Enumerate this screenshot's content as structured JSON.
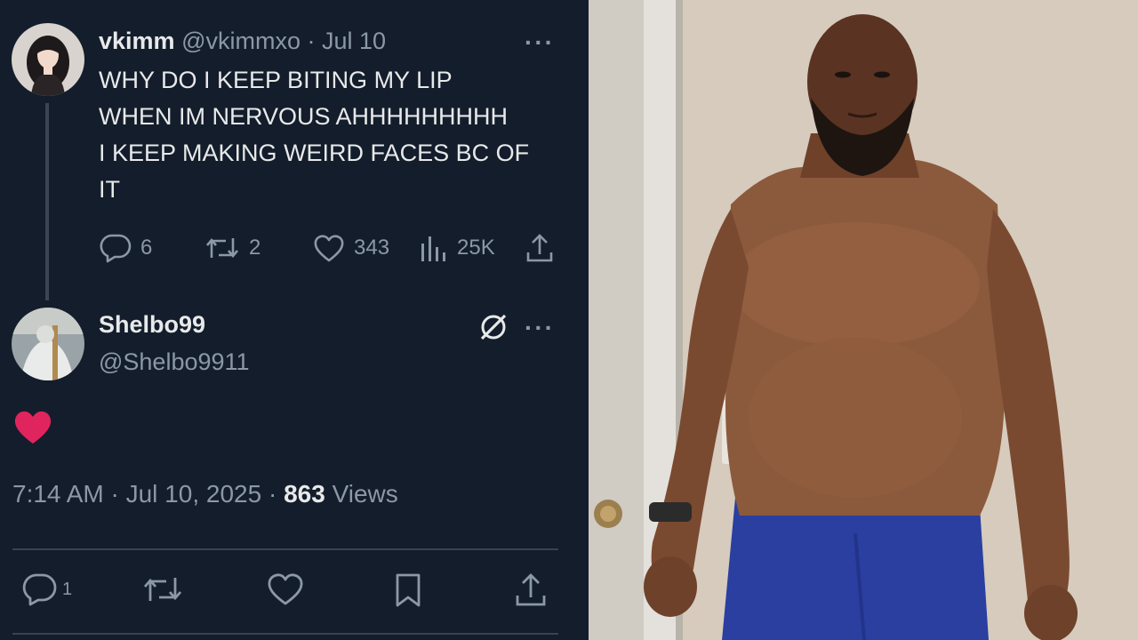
{
  "tweet": {
    "author_name": "vkimm",
    "author_handle": "@vkimmxo",
    "separator": "·",
    "date": "Jul 10",
    "text_lines": [
      "WHY DO I KEEP BITING MY LIP",
      "WHEN IM NERVOUS AHHHHHHHHH",
      "I KEEP MAKING WEIRD FACES BC OF",
      "IT"
    ],
    "stats": {
      "replies": "6",
      "reposts": "2",
      "likes": "343",
      "views": "25K"
    }
  },
  "reply": {
    "author_name": "Shelbo99",
    "author_handle": "@Shelbo9911",
    "content_icon": "red-heart-icon",
    "timestamp": "7:14 AM · Jul 10, 2025",
    "separator": "·",
    "view_count": "863",
    "views_label": "Views",
    "bottom_stats": {
      "replies": "1"
    }
  },
  "colors": {
    "background": "#141d2b",
    "text": "#e7e9ea",
    "muted": "#8b98a5",
    "heart": "#e0245e",
    "divider": "#38444d"
  },
  "photo": {
    "description_icon": "shirtless-man-photo"
  }
}
